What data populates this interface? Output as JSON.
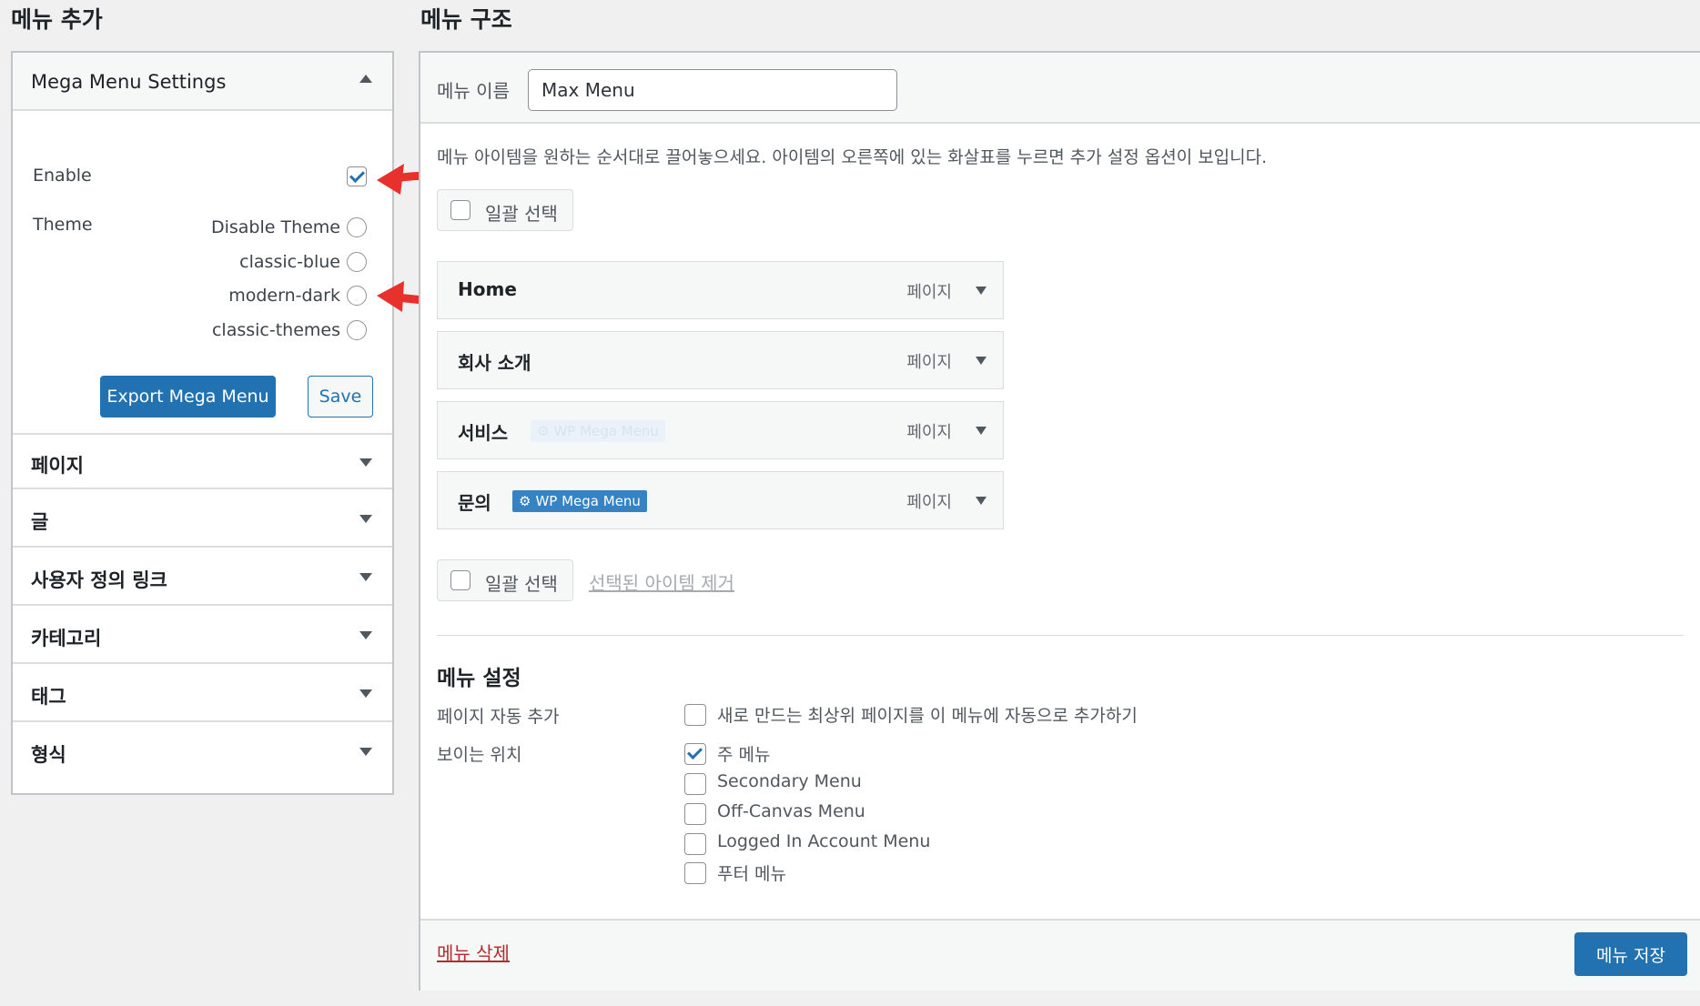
{
  "left": {
    "heading": "메뉴 추가",
    "mega": {
      "title": "Mega Menu Settings",
      "enable_label": "Enable",
      "enable_checked": true,
      "theme_label": "Theme",
      "themes": [
        "Disable Theme",
        "classic-blue",
        "modern-dark",
        "classic-themes"
      ],
      "export_label": "Export Mega Menu",
      "save_label": "Save"
    },
    "sections": [
      "페이지",
      "글",
      "사용자 정의 링크",
      "카테고리",
      "태그",
      "형식"
    ]
  },
  "right": {
    "heading": "메뉴 구조",
    "name_label": "메뉴 이름",
    "name_value": "Max Menu",
    "instructions": "메뉴 아이템을 원하는 순서대로 끌어놓으세요. 아이템의 오른쪽에 있는 화살표를 누르면 추가 설정 옵션이 보입니다.",
    "bulk_select": "일괄 선택",
    "items": [
      {
        "title": "Home",
        "type": "페이지",
        "badge": ""
      },
      {
        "title": "회사 소개",
        "type": "페이지",
        "badge": ""
      },
      {
        "title": "서비스",
        "type": "페이지",
        "badge": "WP Mega Menu"
      },
      {
        "title": "문의",
        "type": "페이지",
        "badge": "WP Mega Menu"
      }
    ],
    "remove_selected": "선택된 아이템 제거",
    "settings": {
      "heading": "메뉴 설정",
      "auto_add_label": "페이지 자동 추가",
      "auto_add_option": "새로 만드는 최상위 페이지를 이 메뉴에 자동으로 추가하기",
      "location_label": "보이는 위치",
      "locations": [
        {
          "label": "주 메뉴",
          "checked": true
        },
        {
          "label": "Secondary Menu",
          "checked": false
        },
        {
          "label": "Off-Canvas Menu",
          "checked": false
        },
        {
          "label": "Logged In Account Menu",
          "checked": false
        },
        {
          "label": "푸터 메뉴",
          "checked": false
        }
      ]
    },
    "delete_menu": "메뉴 삭제",
    "save_menu": "메뉴 저장"
  },
  "colors": {
    "accent": "#2271b1",
    "annotation_arrow": "#e8302c",
    "delete_link": "#b32d2e"
  }
}
